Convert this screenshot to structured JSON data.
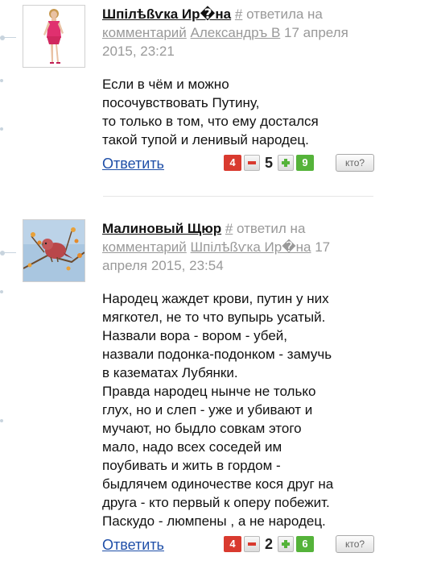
{
  "comments": [
    {
      "author": "Шпiлѣßѵка Ир�на",
      "hash": "#",
      "verb": " ответила на ",
      "comment_label": "комментарий",
      "replied_to": "Александръ В",
      "date": " 17 апреля 2015, 23:21",
      "lines": [
        "Если в чём и можно",
        "посочувствовать Путину,",
        "то только в том, что ему достался",
        "такой тупой и ленивый народец."
      ],
      "reply_label": "Ответить",
      "neg_count": "4",
      "score": "5",
      "pos_count": "9",
      "who_label": "кто?"
    },
    {
      "author": "Малиновый Щюр",
      "hash": "#",
      "verb": " ответил на ",
      "comment_label": "комментарий",
      "replied_to": "Шпiлѣßѵка Ир�на",
      "date": " 17 апреля 2015, 23:54",
      "lines": [
        "Народец жаждет крови, путин у них",
        "мягкотел, не то что вупырь усатый.",
        "Назвали вора - вором - убей,",
        "назвали подонка-подонком - замучь",
        "в казематах Лубянки.",
        "Правда народец нынче не только",
        "глух, но и слеп - уже и убивают и",
        "мучают, но быдло совкам этого",
        "мало, надо всех соседей им",
        "поубивать и жить в гордом -",
        "быдлячем одиночестве кося друг на",
        "друга - кто первый к оперу побежит.",
        "Паскудо - люмпены , а не народец."
      ],
      "reply_label": "Ответить",
      "neg_count": "4",
      "score": "2",
      "pos_count": "6",
      "who_label": "кто?"
    }
  ],
  "colors": {
    "link": "#1f4fa8",
    "meta": "#999999",
    "negative": "#d93a2f",
    "positive": "#55b33a"
  },
  "icons": [
    "minus-icon",
    "plus-icon"
  ]
}
